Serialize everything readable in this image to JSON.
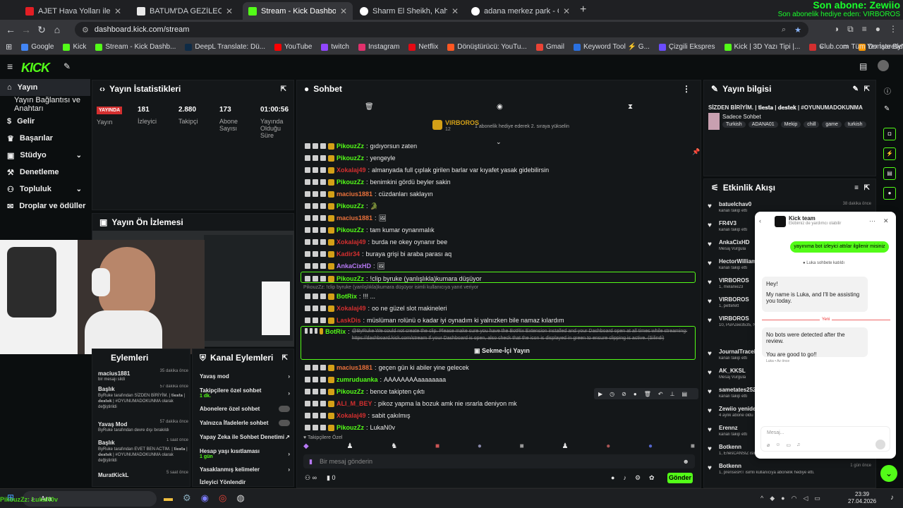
{
  "browser": {
    "tabs": [
      {
        "label": "AJET Hava Yolları ile Prestij Hu",
        "color": "#e31e24"
      },
      {
        "label": "BATUM'DA GEZİLECEK YERLER",
        "color": "#e9e9e9"
      },
      {
        "label": "Stream - Kick Dashboard",
        "color": "#53fc18"
      },
      {
        "label": "Sharm El Sheikh, Kahire - Goog",
        "color": "#ffffff"
      },
      {
        "label": "adana merkez park - Google'da",
        "color": "#ffffff"
      }
    ],
    "url": "dashboard.kick.com/stream",
    "bookmarks": [
      "Google",
      "Kick",
      "Stream - Kick Dashb...",
      "DeepL Translate: Dü...",
      "YouTube",
      "twitch",
      "Instagram",
      "Netflix",
      "Dönüştürücü: YouTu...",
      "Gmail",
      "Keyword Tool ⚡ G...",
      "Çizgili Ekspres",
      "Kick | 3D Yazı Tipi |...",
      "Club.com",
      "Donate ByNoGame..."
    ],
    "all_bookmarks": "Tüm Yer İşaretleri"
  },
  "overlay": {
    "line1": "Son abone: Zewiio",
    "line2": "Son abonelik hediye eden: VIRBOROS"
  },
  "sidebar": {
    "items": [
      {
        "label": "Yayın",
        "icon": "home-icon"
      },
      {
        "label": "Yayın Bağlantısı ve Anahtarı",
        "icon": ""
      },
      {
        "label": "Gelir",
        "icon": "money-icon"
      },
      {
        "label": "Başarılar",
        "icon": "trophy-icon"
      },
      {
        "label": "Stüdyo",
        "icon": "studio-icon"
      },
      {
        "label": "Denetleme",
        "icon": "hammer-icon"
      },
      {
        "label": "Topluluk",
        "icon": "community-icon"
      },
      {
        "label": "Droplar ve ödüller",
        "icon": "gift-icon"
      }
    ]
  },
  "stats": {
    "title": "Yayın İstatistikleri",
    "live_badge": "YAYINDA",
    "cols": [
      {
        "value": "",
        "label": "Yayın"
      },
      {
        "value": "181",
        "label": "İzleyici"
      },
      {
        "value": "2.880",
        "label": "Takipçi"
      },
      {
        "value": "173",
        "label": "Abone Sayısı"
      },
      {
        "value": "01:00:56",
        "label": "Yayında Olduğu Süre"
      }
    ]
  },
  "preview": {
    "title": "Yayın Ön İzlemesi"
  },
  "actions": {
    "title": "Eylemleri",
    "items": [
      {
        "name": "macius1881",
        "time": "35 dakika önce",
        "desc": "bir mesajı sildi"
      },
      {
        "name": "Başlık",
        "time": "57 dakika önce",
        "desc": "ByRuke tarafından SİZDEN BİRİYİM. | 𝐭𝐢𝐞𝐬𝐭𝐚 | 𝐝𝐞𝐬𝐭𝐞𝐤 | #OYUNUMADOKUNMA olarak değiştirildi"
      },
      {
        "name": "Yavaş Mod",
        "time": "57 dakika önce",
        "desc": "ByRuke tarafından devre dışı bırakıldı"
      },
      {
        "name": "Başlık",
        "time": "1 saat önce",
        "desc": "ByRuke tarafından EVET BEN ACTIM. | 𝐭𝐢𝐞𝐬𝐭𝐚 | 𝐝𝐞𝐬𝐭𝐞𝐤 | #OYUNUMADOKUNMA olarak değiştirildi"
      },
      {
        "name": "MuratKickL",
        "time": "5 saat önce",
        "desc": ""
      }
    ]
  },
  "channel_actions": {
    "title": "Kanal Eylemleri",
    "items": [
      {
        "label": "Yavaş mod",
        "sub": "",
        "type": "arrow"
      },
      {
        "label": "Takipçilere özel sohbet",
        "sub": "1 dk.",
        "type": "arrow"
      },
      {
        "label": "Abonelere özel sohbet",
        "sub": "",
        "type": "toggle"
      },
      {
        "label": "Yalnızca İfadelerle sohbet",
        "sub": "",
        "type": "toggle"
      },
      {
        "label": "Yapay Zeka ile Sohbet Denetimi",
        "sub": "",
        "type": "ext"
      },
      {
        "label": "Hesap yaşı kısıtlaması",
        "sub": "1 gün",
        "type": "arrow"
      },
      {
        "label": "Yasaklanmış kelimeler",
        "sub": "",
        "type": "arrow"
      },
      {
        "label": "İzleyici Yönlendir",
        "sub": "",
        "type": "none"
      }
    ]
  },
  "chat": {
    "title": "Sohbet",
    "pinned_user": "VIRBOROS",
    "pinned_count": "12",
    "pinned_text": "1 abonelik hediye ederek 2. sıraya yükselin",
    "messages": [
      {
        "user": "PikouzZz",
        "color": "#53fc18",
        "text": "gıdıyorsun zaten"
      },
      {
        "user": "PikouzZz",
        "color": "#53fc18",
        "text": "yengeyle"
      },
      {
        "user": "Xokalaj49",
        "color": "#d32f2f",
        "text": "almanyada full çıplak girilen barlar var kıyafet yasak gidebilirsin"
      },
      {
        "user": "PikouzZz",
        "color": "#53fc18",
        "text": "benimkini gördü beyler sakin"
      },
      {
        "user": "macius1881",
        "color": "#e9713b",
        "text": "cüzdanları saklayın"
      },
      {
        "user": "PikouzZz",
        "color": "#53fc18",
        "text": "🐊"
      },
      {
        "user": "macius1881",
        "color": "#e9713b",
        "text": "🖼"
      },
      {
        "user": "PikouzZz",
        "color": "#53fc18",
        "text": "tam kumar oynanmalık"
      },
      {
        "user": "Xokalaj49",
        "color": "#d32f2f",
        "text": "burda ne okey oynanır bee"
      },
      {
        "user": "Kadir34",
        "color": "#d32f2f",
        "text": "buraya grişi bi araba parası aq"
      },
      {
        "user": "AnkaCixHD",
        "color": "#b779f5",
        "text": "🖼"
      },
      {
        "user": "PikouzZz",
        "color": "#53fc18",
        "text": "!clip byruke (yanlışlıkla)kumara düşüyor"
      },
      {
        "user": "BotRix",
        "color": "#53fc18",
        "text": "!!! ..."
      },
      {
        "user": "Xokalaj49",
        "color": "#d32f2f",
        "text": "oo ne güzel slot makineleri"
      },
      {
        "user": "LaskDis",
        "color": "#d32f2f",
        "text": "müslüman rolünü o kadar iyi oynadım ki yalnızken bile namaz kılardım"
      },
      {
        "user": "BotRix",
        "color": "#53fc18",
        "text": "@ByRuke We could not create the clip. Please make sure you have the BotRix Extension installed and your Dashboard open at all times while streaming: https://dashboard.kick.com/stream If your Dashboard is open, also check that the icon is displayed in green to ensure clipping is active. (Silindi)"
      },
      {
        "user": "macius1881",
        "color": "#e9713b",
        "text": "geçen gün ki abiler yine gelecek"
      },
      {
        "user": "zumruduanka",
        "color": "#53fc18",
        "text": "AAAAAAAAaaaaaaaa"
      },
      {
        "user": "PikouzZz",
        "color": "#53fc18",
        "text": "bence takipten çıktı"
      },
      {
        "user": "ALI_M_BEY",
        "color": "#d32f2f",
        "text": "pikoz yapma la bozuk amk nie ısrarla deniyon mk"
      },
      {
        "user": "Xokalaj49",
        "color": "#d32f2f",
        "text": "sabit çakılmış"
      },
      {
        "user": "PikouzZz",
        "color": "#53fc18",
        "text": "LukaN0v"
      }
    ],
    "reply_note": "PikouzZz: !clip byruke (yanlışlıkla)kumara düşüyor isimli kullanıcıya yanıt veriyor",
    "sekme": "Sekme-İçi Yayın",
    "followers_only": "Takipçilere Özel",
    "input_placeholder": "Bir mesaj gönderin",
    "send": "Gönder",
    "count_left": "∞",
    "count_right": "0"
  },
  "stream_info": {
    "title": "Yayın bilgisi",
    "stream_title": "SİZDEN BİRİYİM. | 𝐭𝐢𝐞𝐬𝐭𝐚 | 𝐝𝐞𝐬𝐭𝐞𝐤 | #OYUNUMADOKUNMA",
    "category": "Sadece Sohbet",
    "tags": [
      "Turkish",
      "ADANA01",
      "Mekip",
      "chill",
      "game",
      "turkish"
    ]
  },
  "activity": {
    "title": "Etkinlik Akışı",
    "items": [
      {
        "name": "batuelchav0",
        "sub": "kanalı takip etti",
        "time": "38 dakika önce"
      },
      {
        "name": "FR4V3",
        "sub": "kanalı takip etti",
        "time": ""
      },
      {
        "name": "AnkaCixHD",
        "sub": "Mesaj Vurgula",
        "time": ""
      },
      {
        "name": "HectorWilliams",
        "sub": "kanalı takip etti",
        "time": ""
      },
      {
        "name": "VIRBOROS",
        "sub": "1, melanie23",
        "time": ""
      },
      {
        "name": "VIRBOROS",
        "sub": "1, pettefett",
        "time": ""
      },
      {
        "name": "VIRBOROS",
        "sub": "10, PuPZee3535, NamiSaid, ...",
        "time": ""
      },
      {
        "name": "JournalTraceK",
        "sub": "kanalı takip etti",
        "time": ""
      },
      {
        "name": "AK_KKSL",
        "sub": "Mesaj Vurgula",
        "time": ""
      },
      {
        "name": "sametates2525",
        "sub": "kanalı takip etti",
        "time": ""
      },
      {
        "name": "Zewiio yeniden",
        "sub": "4 aylık abone oldu",
        "time": ""
      },
      {
        "name": "Erennz",
        "sub": "kanalı takip etti",
        "time": ""
      },
      {
        "name": "Botkenn",
        "sub": "1, EnesCANSIZ isimli kullanıcıya abonelik hediye etti.",
        "time": ""
      },
      {
        "name": "Botkenn",
        "sub": "1, prensesRT isimli kullanıcıya abonelik hediye etti.",
        "time": "1 gün önce"
      }
    ]
  },
  "support": {
    "name": "Kick team",
    "sub": "Ekibimiz de yardımcı olabilir",
    "user_msg": "yayınıma bot izleyici attılar ilgilenir misiniz",
    "joined": "Luka sohbete katıldı",
    "bot1a": "Hey!",
    "bot1b": "My name is Luka, and I'll be assisting you today.",
    "new_divider": "Yeni",
    "bot2a": "No bots were detected after the review.",
    "bot2b": "You are good to go!!",
    "sign": "Luka • Az önce",
    "placeholder": "Mesaj..."
  },
  "taskbar": {
    "search": "Ara",
    "time": "23:39",
    "date": "27.04.2026",
    "left_overlay": "PikouzZz: LukaN0v"
  }
}
